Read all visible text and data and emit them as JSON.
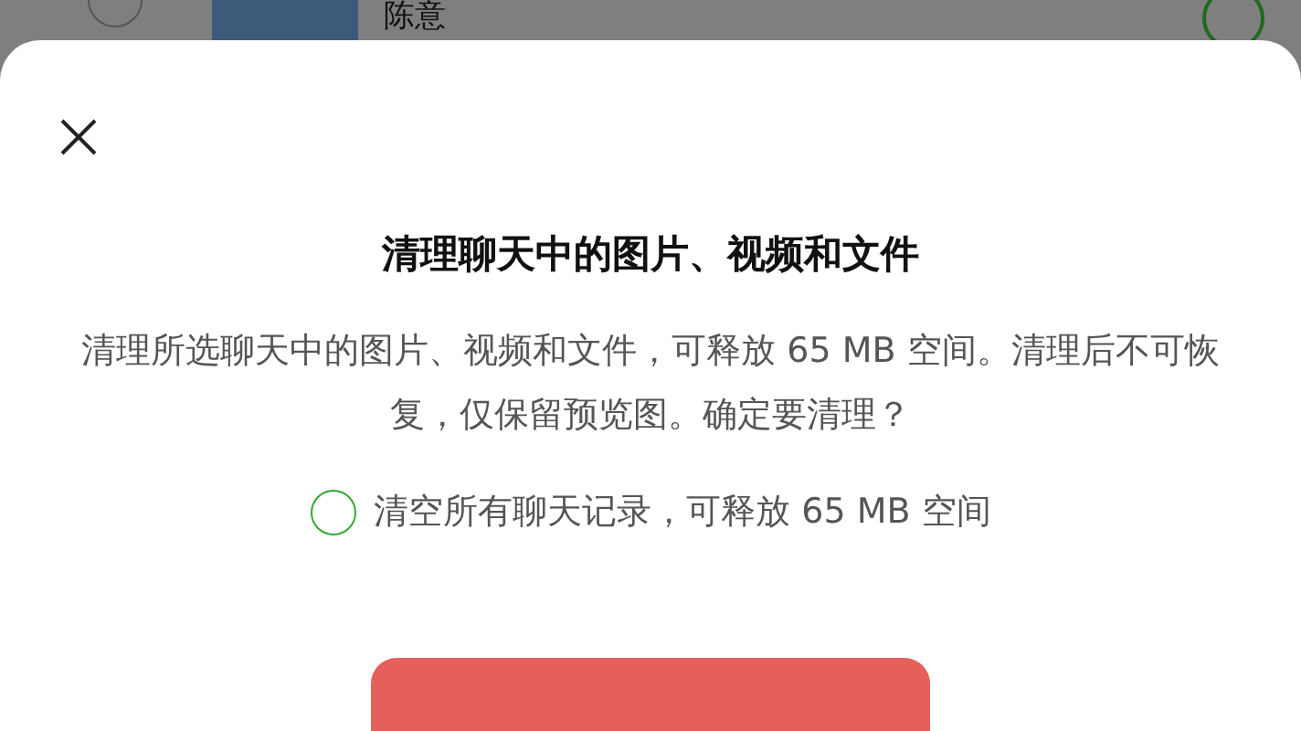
{
  "background_row": {
    "name": "陈意",
    "selected": false
  },
  "dialog": {
    "title": "清理聊天中的图片、视频和文件",
    "message": "清理所选聊天中的图片、视频和文件，可释放 65 MB 空间。清理后不可恢复，仅保留预览图。确定要清理？",
    "option": {
      "label": "清空所有聊天记录，可释放 65 MB 空间",
      "checked": false
    }
  }
}
